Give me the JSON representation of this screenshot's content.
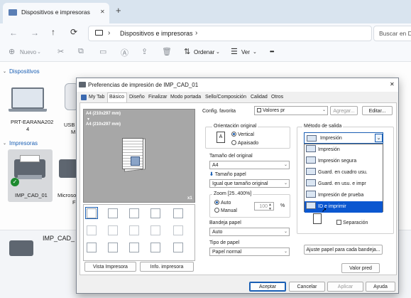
{
  "browser": {
    "tab_title": "Dispositivos e impresoras",
    "close_glyph": "✕",
    "new_tab_glyph": "+",
    "breadcrumb": "Dispositivos e impresoras",
    "breadcrumb_chevron": "›",
    "search_placeholder": "Buscar en D"
  },
  "commands": {
    "new_label": "Nuevo",
    "sort_label": "Ordenar",
    "view_label": "Ver",
    "more_label": "•••"
  },
  "sections": {
    "devices_header": "Dispositivos",
    "printers_header": "Impresoras"
  },
  "devices": [
    {
      "line1": "PRT-EARANA202",
      "line2": "4"
    },
    {
      "line1": "USB",
      "line2": "M"
    }
  ],
  "printers": [
    {
      "label": "IMP_CAD_01"
    },
    {
      "line1": "Microso",
      "line2": "F"
    }
  ],
  "details": {
    "name": "IMP_CAD_"
  },
  "dialog": {
    "title": "Preferencias de impresión de IMP_CAD_01",
    "close_glyph": "✕",
    "tabs": [
      "My Tab",
      "Básico",
      "Diseño",
      "Finalizar",
      "Modo portada",
      "Sello/Composición",
      "Calidad",
      "Otros"
    ],
    "active_tab": "Básico",
    "preview": {
      "paper1": "A4 (210x297 mm)",
      "arrow": "▼",
      "paper2": "A4 (210x297 mm)",
      "copies": "x1",
      "view_printer_button": "Vista Impresora",
      "printer_info_button": "Info. impresora"
    },
    "favorites": {
      "label": "Config. favorita",
      "value": "Valores pr",
      "add_button": "Agregar...",
      "edit_button": "Editar..."
    },
    "orientation": {
      "title": "Orientación original",
      "options": [
        "Vertical",
        "Apaisado"
      ],
      "selected": "Vertical"
    },
    "original_size": {
      "label": "Tamaño del original",
      "value": "A4"
    },
    "paper_size": {
      "label": "Tamaño papel",
      "value": "Igual que tamaño original"
    },
    "zoom": {
      "label": "Zoom [25..400%]",
      "options": [
        "Auto",
        "Manual"
      ],
      "selected": "Auto",
      "value": "100",
      "unit": "%"
    },
    "paper_tray": {
      "label": "Bandeja papel",
      "value": "Auto"
    },
    "paper_type": {
      "label": "Tipo de papel",
      "value": "Papel normal"
    },
    "output_method": {
      "label": "Método de salida",
      "value": "Impresión",
      "options": [
        "Impresión",
        "Impresión segura",
        "Guard. en cuadro usu.",
        "Guard. en usu. e impr",
        "Impresión de prueba",
        "ID e imprimir"
      ],
      "highlighted": "ID e imprimir"
    },
    "separation": {
      "label": "Separación",
      "checked": false
    },
    "adjust_paper_button": "Ajuste papel para cada bandeja...",
    "default_button": "Valor pred",
    "ok_button": "Aceptar",
    "cancel_button": "Cancelar",
    "apply_button": "Aplicar",
    "help_button": "Ayuda",
    "colors": {
      "accent": "#1a5fb4",
      "highlight": "#0b57d0",
      "preview_bg": "#a7a7a7"
    }
  }
}
